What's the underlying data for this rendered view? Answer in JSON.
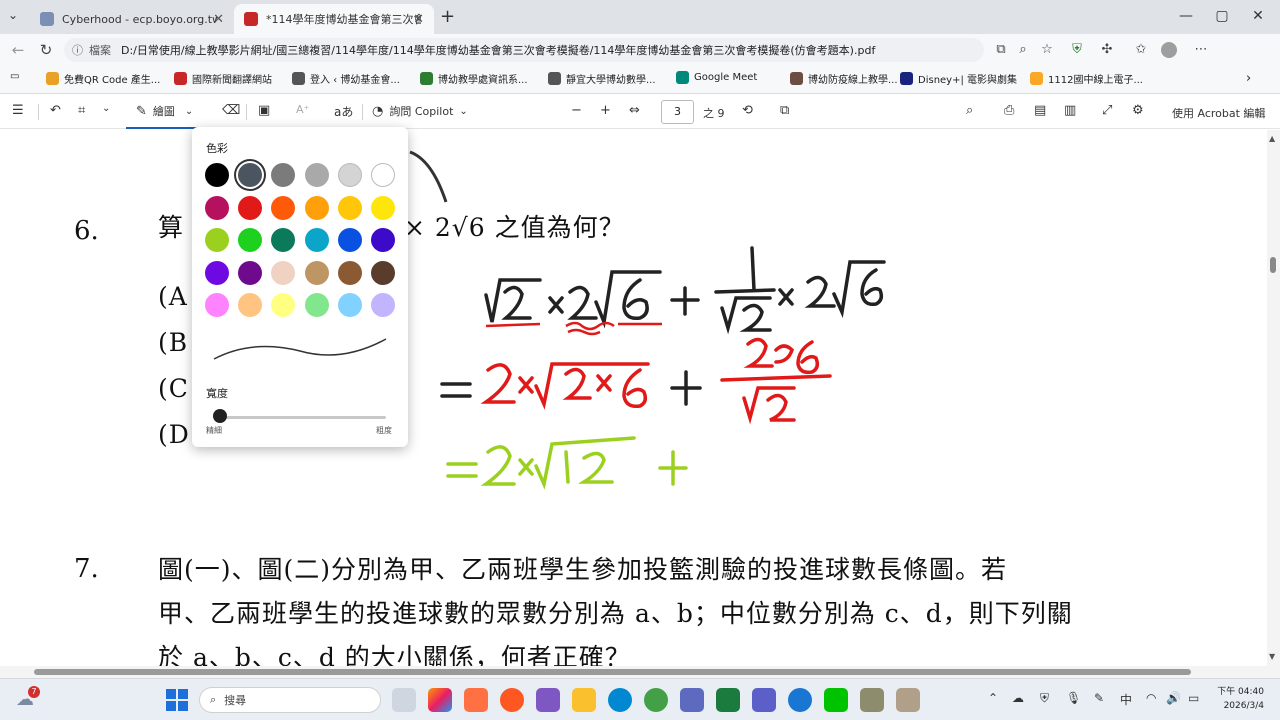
{
  "browser": {
    "tabs": [
      {
        "label": "Cyberhood - ecp.boyo.org.tw",
        "active": false
      },
      {
        "label": "*114學年度博幼基金會第三次會考",
        "active": true
      }
    ],
    "new_tab": "+",
    "window": {
      "minimize": "—",
      "maximize": "▢",
      "close": "✕"
    },
    "address": {
      "label": "檔案",
      "url": "D:/日常使用/線上教學影片網址/國三總複習/114學年度/114學年度博幼基金會第三次會考模擬卷/114學年度博幼基金會第三次會考模擬卷(仿會考題本).pdf"
    },
    "copilot_label": "聊天",
    "bookmarks": [
      {
        "label": "免費QR Code 產生...",
        "color": "#e8a126"
      },
      {
        "label": "國際新聞翻譯網站",
        "color": "#c62828"
      },
      {
        "label": "登入 ‹ 博幼基金會...",
        "color": "#555555"
      },
      {
        "label": "博幼教學處資訊系...",
        "color": "#2e7d32"
      },
      {
        "label": "靜宜大學博幼數學...",
        "color": "#555555"
      },
      {
        "label": "Google Meet",
        "color": "#00897b"
      },
      {
        "label": "博幼防疫線上教學...",
        "color": "#6d4c41"
      },
      {
        "label": "Disney+| 電影與劇集",
        "color": "#1a237e"
      },
      {
        "label": "1112國中線上電子...",
        "color": "#f9a825"
      }
    ]
  },
  "pdf_toolbar": {
    "draw_label": "繪圖",
    "copilot_label": "詢問 Copilot",
    "zoom_out": "−",
    "zoom_in": "+",
    "page_current": "3",
    "page_total": "之 9",
    "acrobat_label": "使用 Acrobat 編輯"
  },
  "color_popup": {
    "title": "色彩",
    "colors": [
      "#000000",
      "#4a5560",
      "#7b7b7b",
      "#a9a9a9",
      "#d4d4d4",
      "#ffffff",
      "#b5115e",
      "#e11919",
      "#ff5a0a",
      "#ffa00a",
      "#ffc60a",
      "#ffe60a",
      "#9bd11e",
      "#1ed11e",
      "#0a7a5a",
      "#0aa5c8",
      "#0a50e1",
      "#3c0ac8",
      "#6e0ae1",
      "#6e0a8c",
      "#f0d2c3",
      "#be9664",
      "#8c5a32",
      "#5a3c2d",
      "#ff82ff",
      "#ffc382",
      "#ffff82",
      "#82e68c",
      "#82d2ff",
      "#c3b4ff"
    ],
    "selected_index": 1,
    "width_label": "寬度",
    "width_min_label": "精細",
    "width_max_label": "粗度",
    "width_value": 0.0
  },
  "document": {
    "q6": {
      "number": "6.",
      "stem_start": "算",
      "stem_end": "× 2√6 之值為何？",
      "options": [
        "(A",
        "(B",
        "(C",
        "(D"
      ]
    },
    "annotations": {
      "line1": "√2 × 2√6 + (1/√2) × 2√6",
      "line2": "= 2 × √(2×6) + 2√6/√2",
      "line3": "= 2 × √12 +"
    },
    "q7": {
      "number": "7.",
      "line1": "圖(一)、圖(二)分別為甲、乙兩班學生參加投籃測驗的投進球數長條圖。若",
      "line2": "甲、乙兩班學生的投進球數的眾數分別為 a、b；中位數分別為 c、d，則下列關",
      "line3": "於 a、b、c、d 的大小關係，何者正確？"
    }
  },
  "taskbar": {
    "weather_badge": "7",
    "search_placeholder": "搜尋",
    "ime": "中",
    "time": "下午 04:40",
    "date": "2026/3/4"
  }
}
